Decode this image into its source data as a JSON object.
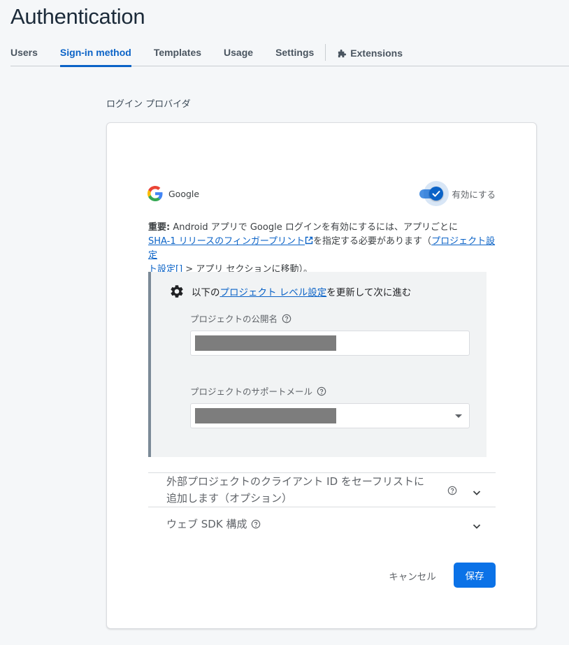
{
  "header": {
    "title": "Authentication"
  },
  "tabs": [
    {
      "label": "Users"
    },
    {
      "label": "Sign-in method",
      "active": true
    },
    {
      "label": "Templates"
    },
    {
      "label": "Usage"
    },
    {
      "label": "Settings"
    },
    {
      "label": "Extensions",
      "icon": "extensions-icon"
    }
  ],
  "section_label": "ログイン プロバイダ",
  "provider": {
    "name": "Google",
    "toggle_label": "有効にする",
    "enabled": true
  },
  "info": {
    "bold": "重要:",
    "text1": " Android アプリで Google ログインを有効にするには、アプリごとに ",
    "link1": "SHA-1 リリースのフィンガープリント",
    "text2": "を指定する必要があります（",
    "link2": "プロジェクト設定",
    "link2_icon": "[]",
    "text3": " > アプリ セクションに移動）。"
  },
  "settings": {
    "prefix": "以下の",
    "link": "プロジェクト レベル設定",
    "suffix": "を更新して次に進む",
    "public_name_label": "プロジェクトの公開名",
    "support_email_label": "プロジェクトのサポートメール"
  },
  "accordions": [
    {
      "line1": "外部プロジェクトのクライアント ID をセーフリストに",
      "line2": "追加します（オプション）"
    },
    {
      "line1": "ウェブ SDK 構成",
      "line2": ""
    }
  ],
  "buttons": {
    "cancel": "キャンセル",
    "save": "保存"
  },
  "colors": {
    "accent": "#0b63c7",
    "save_button": "#0b72e7",
    "box_border": "#7b8a97"
  }
}
